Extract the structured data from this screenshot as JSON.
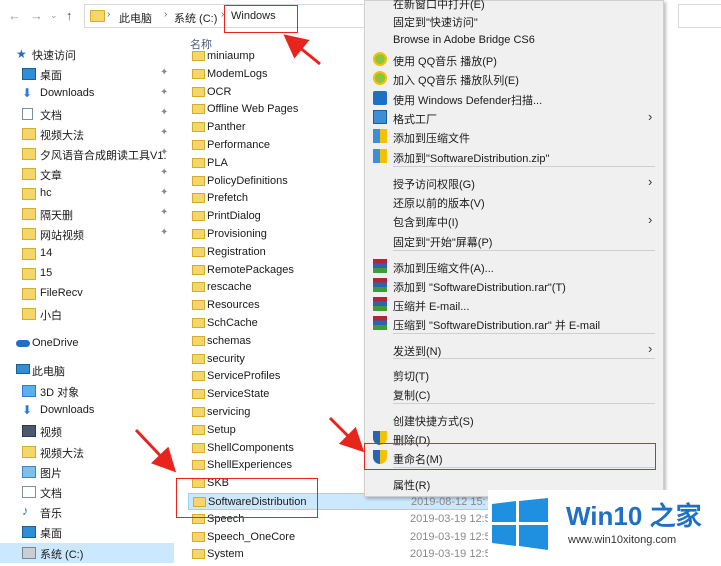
{
  "address": {
    "crumbs": [
      "此电脑",
      "系统 (C:)",
      "Windows"
    ],
    "back_icon": "back-arrow-icon",
    "forward_icon": "forward-arrow-icon",
    "up_icon": "up-arrow-icon"
  },
  "nav": {
    "quick_access": "快速访问",
    "items": [
      {
        "label": "桌面",
        "icon": "desktop-icon",
        "pinned": true
      },
      {
        "label": "Downloads",
        "icon": "downloads-icon",
        "pinned": true
      },
      {
        "label": "文档",
        "icon": "documents-icon",
        "pinned": true
      },
      {
        "label": "视频大法",
        "icon": "folder-icon",
        "pinned": true
      },
      {
        "label": "夕风语音合成朗读工具V1.",
        "icon": "folder-icon",
        "pinned": true
      },
      {
        "label": "文章",
        "icon": "folder-icon",
        "pinned": true
      },
      {
        "label": "hc",
        "icon": "folder-icon",
        "pinned": true
      },
      {
        "label": "隔天删",
        "icon": "folder-icon",
        "pinned": true
      },
      {
        "label": "网站视频",
        "icon": "folder-icon",
        "pinned": true
      },
      {
        "label": "14",
        "icon": "folder-icon",
        "pinned": false
      },
      {
        "label": "15",
        "icon": "folder-icon",
        "pinned": false
      },
      {
        "label": "FileRecv",
        "icon": "folder-icon",
        "pinned": false
      },
      {
        "label": "小白",
        "icon": "folder-icon",
        "pinned": false
      }
    ],
    "onedrive": "OneDrive",
    "this_pc": "此电脑",
    "pc_items": [
      {
        "label": "3D 对象",
        "icon": "3d-objects-icon"
      },
      {
        "label": "Downloads",
        "icon": "downloads-icon"
      },
      {
        "label": "视频",
        "icon": "videos-icon"
      },
      {
        "label": "视频大法",
        "icon": "folder-icon"
      },
      {
        "label": "图片",
        "icon": "pictures-icon"
      },
      {
        "label": "文档",
        "icon": "documents-icon"
      },
      {
        "label": "音乐",
        "icon": "music-icon"
      },
      {
        "label": "桌面",
        "icon": "desktop-icon"
      },
      {
        "label": "系统 (C:)",
        "icon": "drive-icon"
      }
    ]
  },
  "files": {
    "column_name": "名称",
    "rows": [
      {
        "name": "miniaump",
        "date": ""
      },
      {
        "name": "ModemLogs",
        "date": ""
      },
      {
        "name": "OCR",
        "date": ""
      },
      {
        "name": "Offline Web Pages",
        "date": ""
      },
      {
        "name": "Panther",
        "date": ""
      },
      {
        "name": "Performance",
        "date": ""
      },
      {
        "name": "PLA",
        "date": ""
      },
      {
        "name": "PolicyDefinitions",
        "date": ""
      },
      {
        "name": "Prefetch",
        "date": ""
      },
      {
        "name": "PrintDialog",
        "date": ""
      },
      {
        "name": "Provisioning",
        "date": ""
      },
      {
        "name": "Registration",
        "date": ""
      },
      {
        "name": "RemotePackages",
        "date": ""
      },
      {
        "name": "rescache",
        "date": ""
      },
      {
        "name": "Resources",
        "date": ""
      },
      {
        "name": "SchCache",
        "date": ""
      },
      {
        "name": "schemas",
        "date": ""
      },
      {
        "name": "security",
        "date": ""
      },
      {
        "name": "ServiceProfiles",
        "date": ""
      },
      {
        "name": "ServiceState",
        "date": ""
      },
      {
        "name": "servicing",
        "date": ""
      },
      {
        "name": "Setup",
        "date": ""
      },
      {
        "name": "ShellComponents",
        "date": ""
      },
      {
        "name": "ShellExperiences",
        "date": ""
      },
      {
        "name": "SKB",
        "date": ""
      },
      {
        "name": "SoftwareDistribution",
        "date": "2019-08-12 15:"
      },
      {
        "name": "Speech",
        "date": "2019-03-19 12:5"
      },
      {
        "name": "Speech_OneCore",
        "date": "2019-03-19 12:5"
      },
      {
        "name": "System",
        "date": "2019-03-19 12:5"
      }
    ]
  },
  "menu": {
    "items": [
      {
        "label": "在新窗口中打开(E)",
        "icon": "",
        "submenu": false
      },
      {
        "label": "固定到\"快速访问\"",
        "icon": "",
        "submenu": false
      },
      {
        "label": "Browse in Adobe Bridge CS6",
        "icon": "",
        "submenu": false
      },
      {
        "label": "使用 QQ音乐 播放(P)",
        "icon": "qq-music-icon",
        "submenu": false
      },
      {
        "label": "加入 QQ音乐 播放队列(E)",
        "icon": "qq-music-icon",
        "submenu": false
      },
      {
        "label": "使用 Windows Defender扫描...",
        "icon": "windows-defender-icon",
        "submenu": false
      },
      {
        "label": "格式工厂",
        "icon": "format-factory-icon",
        "submenu": true
      },
      {
        "label": "添加到压缩文件",
        "icon": "compress-icon",
        "submenu": false
      },
      {
        "label": "添加到\"SoftwareDistribution.zip\"",
        "icon": "compress-icon",
        "submenu": false
      },
      {
        "label": "授予访问权限(G)",
        "icon": "",
        "submenu": true
      },
      {
        "label": "还原以前的版本(V)",
        "icon": "",
        "submenu": false
      },
      {
        "label": "包含到库中(I)",
        "icon": "",
        "submenu": true
      },
      {
        "label": "固定到\"开始\"屏幕(P)",
        "icon": "",
        "submenu": false
      },
      {
        "label": "添加到压缩文件(A)...",
        "icon": "winrar-icon",
        "submenu": false
      },
      {
        "label": "添加到 \"SoftwareDistribution.rar\"(T)",
        "icon": "winrar-icon",
        "submenu": false
      },
      {
        "label": "压缩并 E-mail...",
        "icon": "winrar-icon",
        "submenu": false
      },
      {
        "label": "压缩到 \"SoftwareDistribution.rar\" 并 E-mail",
        "icon": "winrar-icon",
        "submenu": false
      },
      {
        "label": "发送到(N)",
        "icon": "",
        "submenu": true
      },
      {
        "label": "剪切(T)",
        "icon": "",
        "submenu": false
      },
      {
        "label": "复制(C)",
        "icon": "",
        "submenu": false
      },
      {
        "label": "创建快捷方式(S)",
        "icon": "",
        "submenu": false
      },
      {
        "label": "删除(D)",
        "icon": "uac-shield-icon",
        "submenu": false
      },
      {
        "label": "重命名(M)",
        "icon": "uac-shield-icon",
        "submenu": false
      },
      {
        "label": "属性(R)",
        "icon": "",
        "submenu": false
      }
    ]
  },
  "watermark": {
    "title_en": "Win10",
    "title_zh": "之家",
    "url": "www.win10xitong.com"
  },
  "colors": {
    "accent": "#1f6fc5",
    "selection": "#cce8ff",
    "annotation_red": "#e8241f",
    "folder": "#f5d66a"
  }
}
